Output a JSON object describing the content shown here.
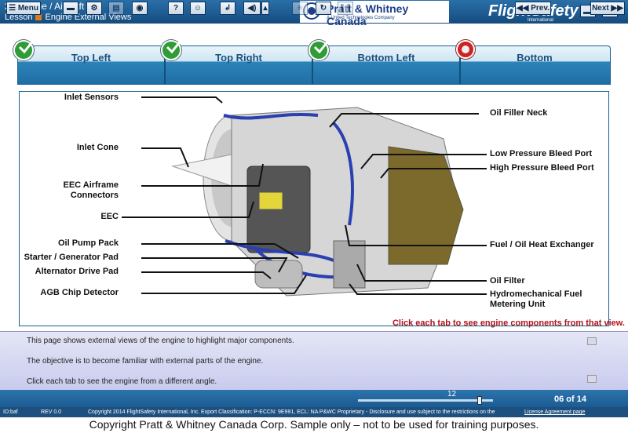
{
  "header": {
    "title": "2 | Engine / Aircraft",
    "lesson_label": "Lesson",
    "lesson_name": "Engine External Views",
    "pw_name": "Pratt & Whitney Canada",
    "pw_sub": "A United Technologies Company",
    "fs_name": "FlightSafety",
    "fs_sub": "International"
  },
  "tabs": [
    {
      "label": "Top Left",
      "status": "complete"
    },
    {
      "label": "Top Right",
      "status": "complete"
    },
    {
      "label": "Bottom Left",
      "status": "complete"
    },
    {
      "label": "Bottom",
      "status": "current"
    }
  ],
  "labels": {
    "inlet_sensors": "Inlet Sensors",
    "inlet_cone": "Inlet Cone",
    "eec_airframe": "EEC Airframe Connectors",
    "eec": "EEC",
    "oil_pump_pack": "Oil Pump Pack",
    "starter_gen": "Starter / Generator Pad",
    "alt_drive": "Alternator Drive Pad",
    "agb_chip": "AGB Chip Detector",
    "oil_filler": "Oil Filler Neck",
    "lp_bleed": "Low Pressure Bleed Port",
    "hp_bleed": "High Pressure Bleed Port",
    "fuel_oil_hx": "Fuel / Oil Heat Exchanger",
    "oil_filter": "Oil Filter",
    "hmu": "Hydromechanical Fuel Metering Unit"
  },
  "instruction": "Click each tab to see engine components from that view.",
  "text_panel": [
    "This page shows external views of the engine to highlight major components.",
    "The objective is to become familiar with external parts of the engine.",
    "Click each tab to see the engine from a different angle."
  ],
  "toolbar": {
    "menu": "Menu",
    "slider_value": "12",
    "prev": "Prev.",
    "page": "06 of 14",
    "next": "Next"
  },
  "footer": {
    "id": "ID:baf",
    "rev": "REV 0.0",
    "copyright": "Copyright  2014 FlightSafety International, Inc.   Export Classification: P-ECCN: 9E991, ECL: NA   P&WC Proprietary - Disclosure and use subject to the restrictions on the",
    "license": "License Agreement page"
  },
  "watermark": "Copyright Pratt & Whitney Canada Corp. Sample only – not to be used for training purposes."
}
